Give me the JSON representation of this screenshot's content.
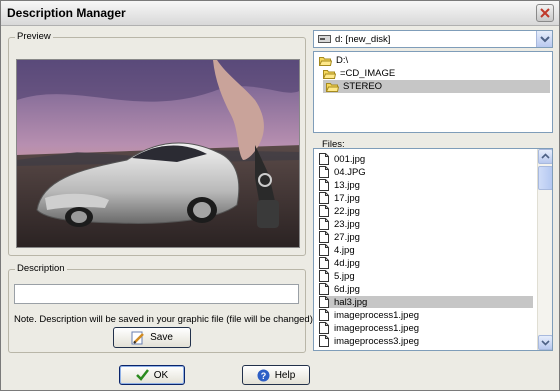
{
  "window": {
    "title": "Description Manager"
  },
  "preview": {
    "label": "Preview"
  },
  "description": {
    "label": "Description",
    "value": "",
    "note": "Note. Description will be saved in your graphic file (file will be changed).",
    "save_label": "Save"
  },
  "drive": {
    "selected": "d: [new_disk]"
  },
  "tree": {
    "items": [
      {
        "label": "D:\\"
      },
      {
        "label": "=CD_IMAGE"
      },
      {
        "label": "STEREO"
      }
    ]
  },
  "files": {
    "label": "Files:",
    "items": [
      "001.jpg",
      "04.JPG",
      "13.jpg",
      "17.jpg",
      "22.jpg",
      "23.jpg",
      "27.jpg",
      "4.jpg",
      "4d.jpg",
      "5.jpg",
      "6d.jpg",
      "hal3.jpg",
      "imageprocess1.jpeg",
      "imageprocess1.jpeg",
      "imageprocess3.jpeg"
    ]
  },
  "buttons": {
    "ok_label": "OK",
    "help_label": "Help"
  },
  "colors": {
    "accent": "#0a246a",
    "selection": "#c6c6c6",
    "ok_check": "#2a8a1f"
  }
}
